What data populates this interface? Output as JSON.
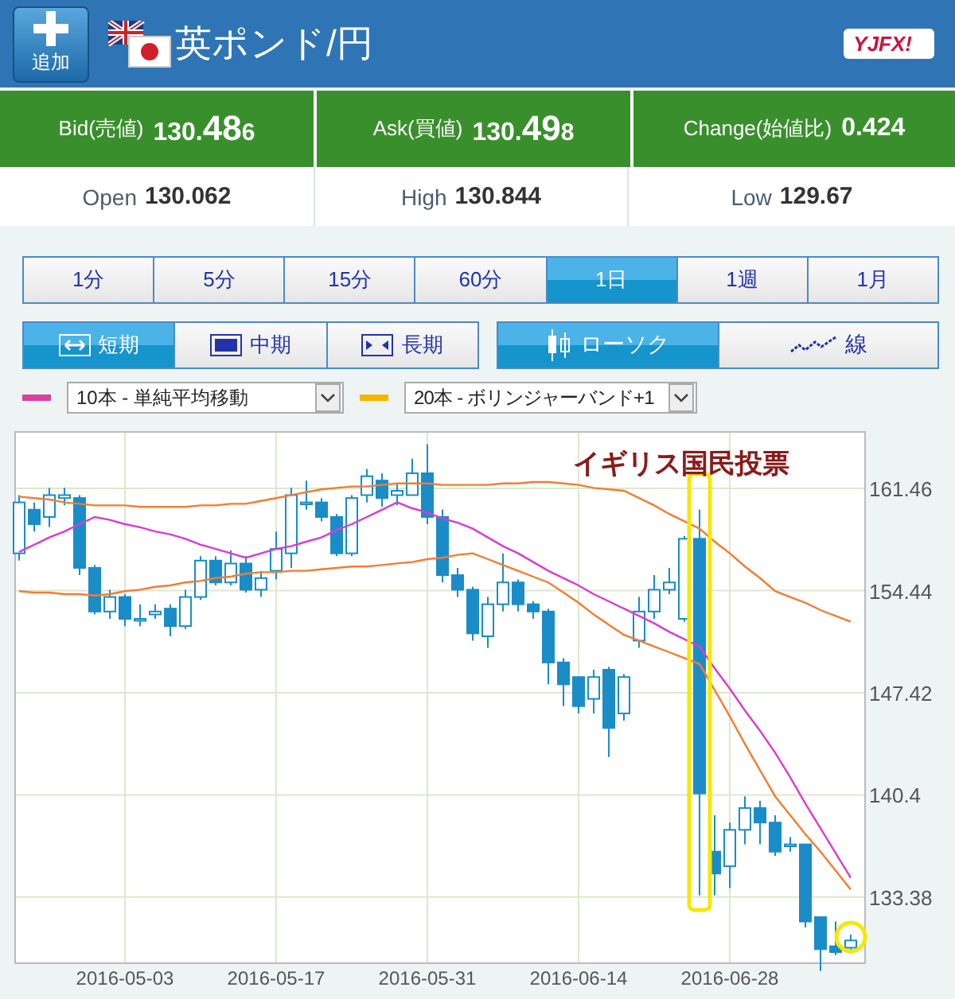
{
  "header": {
    "add_button": {
      "label": "追加"
    },
    "pair": "英ポンド/円",
    "logo": "YJFX!"
  },
  "quotes": [
    {
      "label": "Bid(売値)",
      "prefix": "130.",
      "big": "48",
      "suffix": "6"
    },
    {
      "label": "Ask(買値)",
      "prefix": "130.",
      "big": "49",
      "suffix": "8"
    },
    {
      "label": "Change(始値比)",
      "prefix": "0.424"
    }
  ],
  "stats": [
    {
      "label": "Open",
      "value": "130.062"
    },
    {
      "label": "High",
      "value": "130.844"
    },
    {
      "label": "Low",
      "value": "129.67"
    }
  ],
  "timeframes": [
    {
      "label": "1分",
      "selected": false
    },
    {
      "label": "5分",
      "selected": false
    },
    {
      "label": "15分",
      "selected": false
    },
    {
      "label": "60分",
      "selected": false
    },
    {
      "label": "1日",
      "selected": true
    },
    {
      "label": "1週",
      "selected": false
    },
    {
      "label": "1月",
      "selected": false
    }
  ],
  "periods": [
    {
      "kind": "short",
      "label": "短期",
      "selected": true
    },
    {
      "kind": "mid",
      "label": "中期",
      "selected": false
    },
    {
      "kind": "long",
      "label": "長期",
      "selected": false
    }
  ],
  "chart_types": [
    {
      "kind": "candle",
      "label": "ローソク",
      "selected": true
    },
    {
      "kind": "line",
      "label": "線",
      "selected": false
    }
  ],
  "indicators": [
    {
      "color": "#d9409f",
      "value": "10本 - 単純平均移動"
    },
    {
      "color": "#f7b500",
      "value": "20本 - ボリンジャーバンド+1"
    }
  ],
  "chart": {
    "annotation": "イギリス国民投票",
    "chart_data": {
      "type": "candlestick",
      "grid": true,
      "categories": [
        null,
        null,
        null,
        null,
        null,
        null,
        null,
        "2016-05-03",
        null,
        null,
        null,
        null,
        null,
        null,
        null,
        null,
        null,
        "2016-05-17",
        null,
        null,
        null,
        null,
        null,
        null,
        null,
        null,
        null,
        "2016-05-31",
        null,
        null,
        null,
        null,
        null,
        null,
        null,
        null,
        null,
        "2016-06-14",
        null,
        null,
        null,
        null,
        null,
        null,
        null,
        null,
        null,
        "2016-06-28",
        null,
        null,
        null,
        null,
        null,
        null,
        null,
        null
      ],
      "ylim": [
        128.89,
        165.29
      ],
      "yticks": [
        161.46,
        154.44,
        147.42,
        140.4,
        133.38
      ],
      "ohlc": [
        [
          157,
          161,
          156.5,
          160.5
        ],
        [
          160,
          160.5,
          158.5,
          159
        ],
        [
          159.5,
          161.5,
          158.8,
          161
        ],
        [
          160.8,
          161.5,
          160.3,
          161
        ],
        [
          160.8,
          161,
          155.5,
          156
        ],
        [
          156,
          156.2,
          152.8,
          153
        ],
        [
          153,
          154.5,
          152.5,
          154
        ],
        [
          154,
          154.2,
          152,
          152.5
        ],
        [
          152.5,
          153.5,
          152,
          152.5
        ],
        [
          152.8,
          153.5,
          152.5,
          153
        ],
        [
          153.2,
          153.5,
          151.3,
          152
        ],
        [
          152,
          154.5,
          151.8,
          154
        ],
        [
          154,
          156.8,
          153.8,
          156.5
        ],
        [
          156.5,
          156.8,
          154.8,
          155
        ],
        [
          155,
          157.2,
          154.8,
          156.3
        ],
        [
          156.3,
          156.8,
          154.3,
          154.5
        ],
        [
          154.5,
          155.8,
          154,
          155.3
        ],
        [
          155.8,
          158.5,
          155.2,
          157.3
        ],
        [
          157,
          161.5,
          156,
          161
        ],
        [
          160.5,
          162,
          160,
          160.5
        ],
        [
          160.5,
          160.8,
          159.2,
          159.5
        ],
        [
          159.5,
          159.7,
          156.8,
          157
        ],
        [
          157,
          161,
          156.8,
          160.8
        ],
        [
          161,
          162.8,
          160.5,
          162.3
        ],
        [
          162,
          162.5,
          160.2,
          160.8
        ],
        [
          161,
          161.8,
          160.3,
          161.3
        ],
        [
          161,
          163.5,
          161,
          162.5
        ],
        [
          162.5,
          164.5,
          159,
          159.5
        ],
        [
          159.5,
          160,
          155,
          155.5
        ],
        [
          155.5,
          156,
          154,
          154.5
        ],
        [
          154.5,
          154.7,
          151,
          151.5
        ],
        [
          151.3,
          154,
          150.5,
          153.5
        ],
        [
          153.5,
          157,
          153,
          155
        ],
        [
          155,
          155.2,
          153,
          153.5
        ],
        [
          153.5,
          153.7,
          152.5,
          153
        ],
        [
          153,
          153.2,
          148,
          149.5
        ],
        [
          149.5,
          149.8,
          146.5,
          148
        ],
        [
          148.5,
          148.5,
          146,
          146.5
        ],
        [
          147,
          149,
          146,
          148.5
        ],
        [
          149,
          149.2,
          143,
          145
        ],
        [
          146,
          148.7,
          145.5,
          148.5
        ],
        [
          151,
          154,
          150.5,
          153
        ],
        [
          153,
          155.5,
          152.5,
          154.5
        ],
        [
          154.5,
          156,
          154.2,
          155
        ],
        [
          152.5,
          158.2,
          152.3,
          158
        ],
        [
          158,
          160,
          133.5,
          140.5
        ],
        [
          136.5,
          139,
          133.5,
          135
        ],
        [
          135.5,
          138.5,
          134,
          138
        ],
        [
          138,
          140.3,
          137,
          139.5
        ],
        [
          139.5,
          140,
          137,
          138.5
        ],
        [
          138.5,
          139,
          136.2,
          136.5
        ],
        [
          137,
          137.5,
          136.5,
          137
        ],
        [
          137,
          137,
          131.3,
          131.7
        ],
        [
          132,
          132,
          128.3,
          129.8
        ],
        [
          130,
          131.7,
          129.4,
          129.6
        ],
        [
          129.9,
          130.8,
          129.6,
          130.4
        ]
      ],
      "series": [
        {
          "type": "line",
          "color": "#d93cd0",
          "values": [
            157.1,
            157.6,
            158.1,
            158.5,
            159.0,
            159.5,
            159.3,
            159.0,
            158.8,
            158.5,
            158.3,
            158.0,
            157.6,
            157.3,
            157.0,
            156.7,
            157.0,
            157.3,
            157.5,
            157.8,
            158.1,
            158.6,
            159.0,
            159.5,
            160.0,
            160.5,
            160.1,
            159.8,
            159.4,
            159.1,
            158.7,
            158.1,
            157.5,
            157.0,
            156.4,
            155.8,
            155.3,
            154.8,
            154.2,
            153.7,
            153.2,
            152.7,
            152.2,
            151.6,
            151.1,
            150.6,
            149.1,
            147.7,
            146.2,
            144.8,
            143.3,
            141.6,
            139.8,
            138.1,
            136.4,
            134.7
          ]
        },
        {
          "type": "line",
          "color": "#f47c30",
          "values": [
            160.9,
            160.8,
            160.7,
            160.5,
            160.4,
            160.3,
            160.3,
            160.3,
            160.2,
            160.2,
            160.2,
            160.2,
            160.3,
            160.3,
            160.4,
            160.4,
            160.6,
            160.8,
            161.0,
            161.2,
            161.4,
            161.5,
            161.6,
            161.6,
            161.7,
            161.8,
            161.8,
            161.8,
            161.7,
            161.7,
            161.7,
            161.7,
            161.8,
            161.8,
            161.9,
            161.9,
            161.8,
            161.7,
            161.5,
            161.4,
            161.3,
            160.8,
            160.3,
            159.7,
            159.2,
            158.7,
            157.8,
            157.0,
            156.1,
            155.3,
            154.4,
            154.0,
            153.6,
            153.1,
            152.7,
            152.3
          ]
        },
        {
          "type": "line",
          "color": "#f47c30",
          "values": [
            154.4,
            154.3,
            154.3,
            154.2,
            154.2,
            154.1,
            154.2,
            154.4,
            154.5,
            154.7,
            154.8,
            155.0,
            155.1,
            155.3,
            155.4,
            155.6,
            155.7,
            155.7,
            155.8,
            155.8,
            155.9,
            156.0,
            156.1,
            156.1,
            156.2,
            156.3,
            156.4,
            156.6,
            156.7,
            156.9,
            157.0,
            156.6,
            156.2,
            155.8,
            155.4,
            155.0,
            154.3,
            153.6,
            152.8,
            152.1,
            151.4,
            151.0,
            150.6,
            150.2,
            149.8,
            149.4,
            147.6,
            145.8,
            143.9,
            142.1,
            140.3,
            139.0,
            137.7,
            136.5,
            135.2,
            133.9
          ]
        }
      ]
    }
  }
}
